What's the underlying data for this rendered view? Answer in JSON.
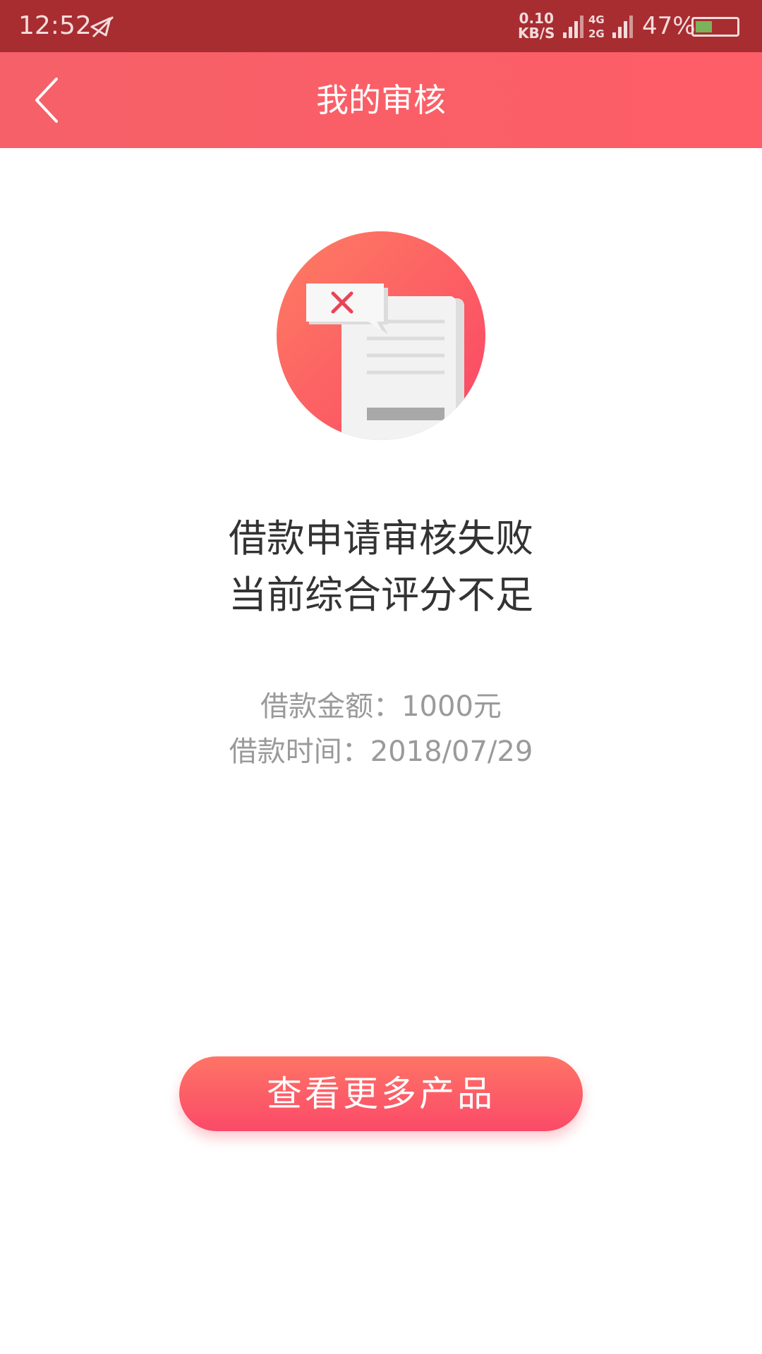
{
  "status_bar": {
    "time": "12:52",
    "speed_value": "0.10",
    "speed_unit": "KB/S",
    "net_1": "4G",
    "net_2": "2G",
    "battery": "47%",
    "battery_level": 0.47,
    "battery_color": "#7cb35a"
  },
  "nav": {
    "title": "我的审核",
    "back_icon": "chevron-left-icon"
  },
  "result": {
    "illustration_icon": "rejected-document-icon",
    "line1": "借款申请审核失败",
    "line2": "当前综合评分不足",
    "amount_line": "借款金额：1000元",
    "date_line": "借款时间：2018/07/29"
  },
  "cta": {
    "label": "查看更多产品"
  },
  "colors": {
    "status_bar": "#a72d31",
    "nav_bar": "#fe5e67",
    "accent": "#fb4a68",
    "headline_text": "#333333",
    "detail_text": "#9a9a9a"
  }
}
